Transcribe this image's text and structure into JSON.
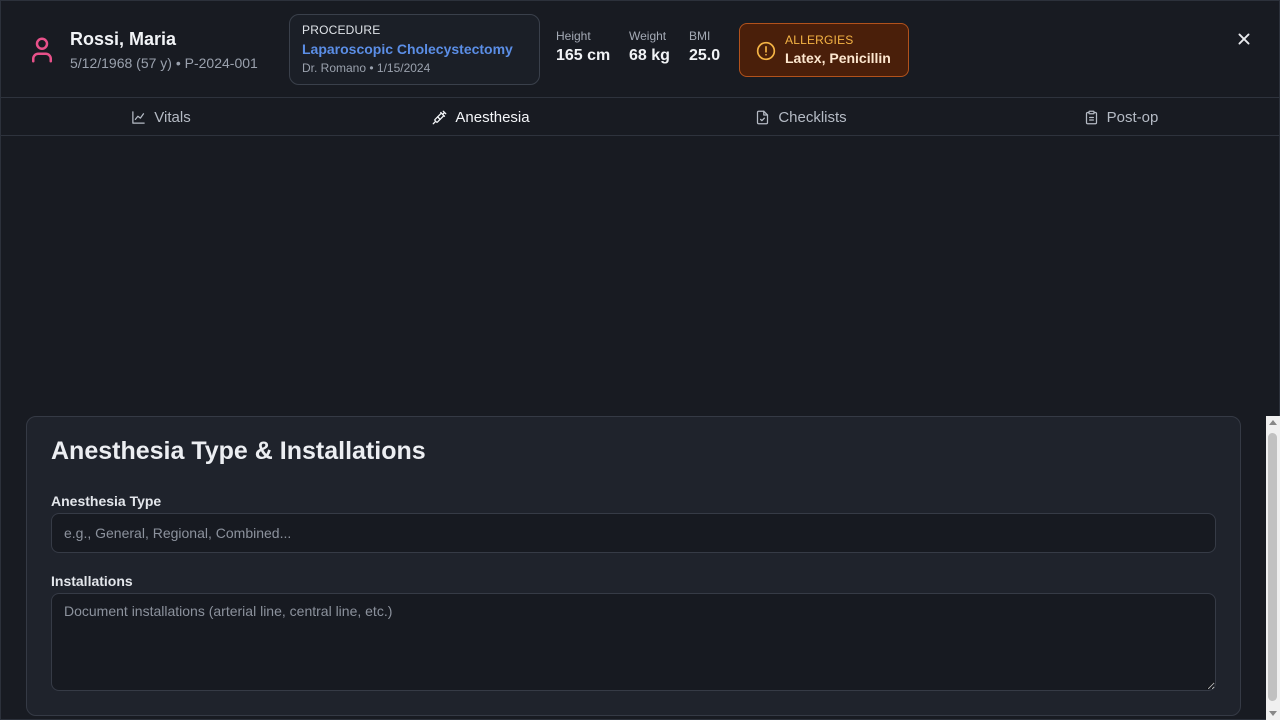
{
  "patient": {
    "name": "Rossi, Maria",
    "meta": "5/12/1968 (57 y) • P-2024-001",
    "icon": "user-icon",
    "accent": "#e8518a"
  },
  "procedure": {
    "label": "PROCEDURE",
    "name": "Laparoscopic Cholecystectomy",
    "doctor_date": "Dr. Romano • 1/15/2024"
  },
  "metrics": {
    "height": {
      "label": "Height",
      "value": "165 cm"
    },
    "weight": {
      "label": "Weight",
      "value": "68 kg"
    },
    "bmi": {
      "label": "BMI",
      "value": "25.0"
    }
  },
  "allergies": {
    "label": "ALLERGIES",
    "value": "Latex, Penicillin",
    "icon": "alert-circle-icon",
    "color": "#f5b445"
  },
  "tabs": [
    {
      "label": "Vitals",
      "icon": "chart-line-icon",
      "active": false
    },
    {
      "label": "Anesthesia",
      "icon": "syringe-icon",
      "active": true
    },
    {
      "label": "Checklists",
      "icon": "file-check-icon",
      "active": false
    },
    {
      "label": "Post-op",
      "icon": "clipboard-icon",
      "active": false
    }
  ],
  "anesthesia_card": {
    "title": "Anesthesia Type & Installations",
    "type_label": "Anesthesia Type",
    "type_value": "",
    "type_placeholder": "e.g., General, Regional, Combined...",
    "installations_label": "Installations",
    "installations_value": "",
    "installations_placeholder": "Document installations (arterial line, central line, etc.)"
  },
  "close_icon": "close-icon"
}
